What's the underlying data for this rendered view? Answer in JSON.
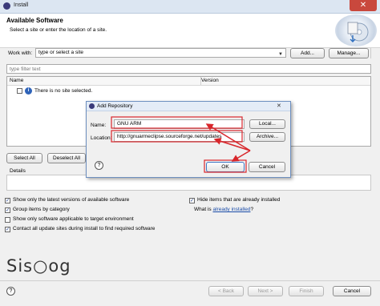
{
  "window": {
    "title": "Install",
    "close_glyph": "✕"
  },
  "banner": {
    "title": "Available Software",
    "subtitle": "Select a site or enter the location of a site."
  },
  "work_with": {
    "label": "Work with:",
    "value": "type or select a site",
    "add_label": "Add...",
    "manage_label": "Manage..."
  },
  "filter": {
    "placeholder": "type filter text"
  },
  "tree": {
    "columns": [
      "Name",
      "Version"
    ],
    "rows": [
      {
        "text": "There is no site selected."
      }
    ]
  },
  "selection": {
    "select_all": "Select All",
    "deselect_all": "Deselect All"
  },
  "details": {
    "label": "Details"
  },
  "options": {
    "left": [
      {
        "label": "Show only the latest versions of available software",
        "checked": true
      },
      {
        "label": "Group items by category",
        "checked": true
      },
      {
        "label": "Show only software applicable to target environment",
        "checked": false
      },
      {
        "label": "Contact all update sites during install to find required software",
        "checked": true
      }
    ],
    "hide_installed": {
      "label": "Hide items that are already installed",
      "checked": true
    },
    "what_is": {
      "prefix": "What is ",
      "link": "already installed",
      "suffix": "?"
    }
  },
  "footer": {
    "back": "< Back",
    "next": "Next >",
    "finish": "Finish",
    "cancel": "Cancel"
  },
  "dialog": {
    "title": "Add Repository",
    "name_label": "Name:",
    "name_value": "GNU ARM",
    "local_label": "Local...",
    "location_label": "Location:",
    "location_value": "http://gnuarmeclipse.sourceforge.net/updates",
    "archive_label": "Archive...",
    "ok_label": "OK",
    "cancel_label": "Cancel",
    "close_glyph": "✕"
  },
  "watermark": "Sis○og",
  "colors": {
    "annotation_red": "#d8262b",
    "link_blue": "#1a4ca8",
    "close_red": "#c9483d"
  }
}
